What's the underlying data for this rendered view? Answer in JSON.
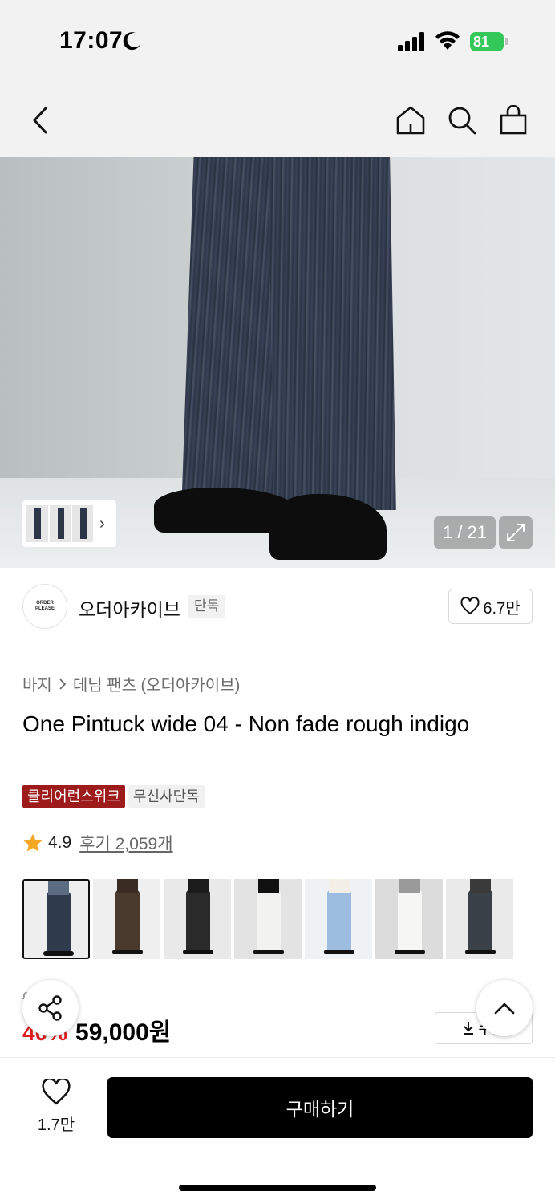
{
  "status_bar": {
    "time": "17:07",
    "battery": "81"
  },
  "nav": {
    "back_icon": "chevron-left-icon",
    "home_icon": "home-icon",
    "search_icon": "search-icon",
    "cart_icon": "shopping-bag-icon"
  },
  "gallery": {
    "counter": "1 / 21",
    "thumb_chevron": "›"
  },
  "brand": {
    "logo_text": "ORDER PLEASE",
    "name": "오더아카이브",
    "badge": "단독",
    "likes": "6.7만"
  },
  "breadcrumb": {
    "category": "바지",
    "subcategory": "데님 팬츠 (오더아카이브)"
  },
  "product": {
    "title": "One Pintuck wide 04 - Non fade rough indigo",
    "tags": [
      "클리어런스위크",
      "무신사단독"
    ],
    "rating": "4.9",
    "review_label": "후기 2,059개"
  },
  "color_options": [
    {
      "top": "#5b6b80",
      "legs": "#2f3a4d",
      "bg": "#eeeeee"
    },
    {
      "top": "#3a2c22",
      "legs": "#4a3a2e",
      "bg": "#efefef"
    },
    {
      "top": "#1b1b1b",
      "legs": "#2a2a2a",
      "bg": "#e9e9e9"
    },
    {
      "top": "#111111",
      "legs": "#f2f2f0",
      "bg": "#e3e3e3"
    },
    {
      "top": "#f3efe6",
      "legs": "#9dbde0",
      "bg": "#eef2f5"
    },
    {
      "top": "#9a9a9a",
      "legs": "#f6f6f4",
      "bg": "#dcdcdc"
    },
    {
      "top": "#3a3a3a",
      "legs": "#3b4148",
      "bg": "#eaeaea"
    }
  ],
  "price": {
    "original": "9 0원",
    "discount": "40%",
    "sale": "59,000원"
  },
  "coupon": {
    "label": "쿠폰"
  },
  "bottom": {
    "wish_count": "1.7만",
    "buy_label": "구매하기"
  },
  "colors": {
    "accent_red": "#9d1b1b",
    "discount_red": "#e02020",
    "star": "#f5a623",
    "battery_green": "#34c759"
  }
}
